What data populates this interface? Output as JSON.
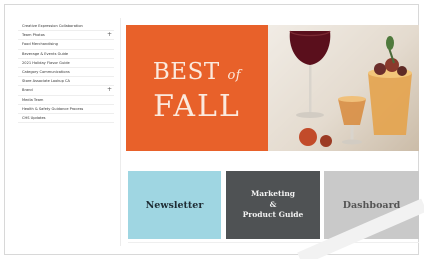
{
  "sidebar": {
    "items": [
      {
        "label": "Creative Expression Collaboration",
        "plus": ""
      },
      {
        "label": "Team Photos",
        "plus": "+"
      },
      {
        "label": "Food Merchandising",
        "plus": ""
      },
      {
        "label": "Beverage & Events Guide",
        "plus": ""
      },
      {
        "label": "2021 Holiday Flavor Guide",
        "plus": ""
      },
      {
        "label": "Category Communications",
        "plus": ""
      },
      {
        "label": "Store Associate Lookup CA",
        "plus": ""
      },
      {
        "label": "Brand",
        "plus": "+"
      },
      {
        "label": "Media Team",
        "plus": ""
      },
      {
        "label": "Health & Safety Guidance Process",
        "plus": ""
      },
      {
        "label": "CHS Updates",
        "plus": ""
      }
    ]
  },
  "hero": {
    "best": "BEST",
    "of": "of",
    "fall": "FALL"
  },
  "tiles": {
    "newsletter": "Newsletter",
    "marketing": "Marketing\n&\nProduct Guide",
    "dashboard": "Dashboard"
  },
  "colors": {
    "hero_orange": "#e8612a",
    "newsletter_tile": "#9fd6e2",
    "marketing_tile": "#4f5254",
    "dashboard_tile": "#c9c9c9"
  }
}
